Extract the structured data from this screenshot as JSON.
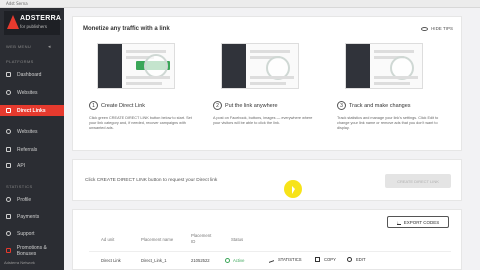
{
  "browser": {
    "tab_label": "Adst Serna"
  },
  "sidebar": {
    "brand": "ADSTERRA",
    "brand_sub": "for publishers",
    "sections": [
      {
        "label": "WEB MENU"
      },
      {
        "label": "PLATFORMS"
      },
      {
        "label": "STATISTICS"
      }
    ],
    "items": [
      {
        "label": "Dashboard",
        "icon": "dashboard-icon"
      },
      {
        "label": "Websites",
        "icon": "globe-icon"
      },
      {
        "label": "Direct Links",
        "icon": "link-icon",
        "active": true
      },
      {
        "label": "Websites",
        "icon": "globe-icon"
      },
      {
        "label": "Referrals",
        "icon": "users-icon"
      },
      {
        "label": "API",
        "icon": "code-icon"
      },
      {
        "label": "Profile",
        "icon": "user-icon"
      },
      {
        "label": "Payments",
        "icon": "wallet-icon"
      },
      {
        "label": "Support",
        "icon": "help-icon"
      },
      {
        "label": "Promotions & Bonuses",
        "icon": "gift-icon"
      }
    ],
    "footer": "Adsterra Network"
  },
  "colors": {
    "accent": "#e63a2e",
    "success": "#3aa658",
    "sidebar_bg": "#2b2d33"
  },
  "tips": {
    "title": "Monetize any traffic with a link",
    "hide_label": "HIDE TIPS",
    "steps": [
      {
        "number": "1",
        "heading": "Create Direct Link",
        "desc": "Click green CREATE DIRECT LINK button below to start. Set your link category and, if needed, recover campaigns with unwanted ads."
      },
      {
        "number": "2",
        "heading": "Put the link anywhere",
        "desc": "A post on Facebook, buttons, images — everywhere where your visitors will be able to click the link."
      },
      {
        "number": "3",
        "heading": "Track and make changes",
        "desc": "Track statistics and manage your link's settings. Click Edit to change your link name or remove ads that you don't want to display."
      }
    ]
  },
  "create": {
    "hint": "Click CREATE DIRECT LINK button to request your Direct link",
    "button_label": "CREATE DIRECT LINK"
  },
  "table": {
    "export_label": "EXPORT CODES",
    "headers": [
      "Ad unit",
      "Placement name",
      "Placement ID",
      "Status"
    ],
    "rows": [
      {
        "ad_unit": "Direct Link",
        "placement_name": "Direct_Link_1",
        "placement_id": "21052522",
        "status": "Active"
      }
    ],
    "actions": {
      "statistics": "STATISTICS",
      "copy": "COPY",
      "edit": "EDIT"
    }
  }
}
